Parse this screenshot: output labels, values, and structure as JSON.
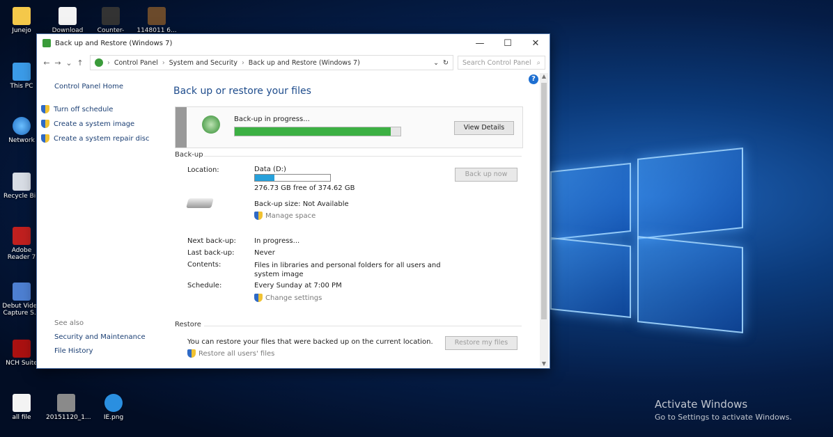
{
  "desktop": {
    "icons": [
      {
        "label": "Junejo",
        "icon": "folder-icon"
      },
      {
        "label": "Download",
        "icon": "document-icon"
      },
      {
        "label": "Counter-Str...",
        "icon": "app-icon"
      },
      {
        "label": "1148011 6...",
        "icon": "image-icon"
      },
      {
        "label": "This PC",
        "icon": "computer-icon"
      },
      {
        "label": "Network",
        "icon": "network-icon"
      },
      {
        "label": "Recycle Bin",
        "icon": "recycle-bin-icon"
      },
      {
        "label": "Adobe Reader 7",
        "icon": "pdf-icon"
      },
      {
        "label": "Debut Video Capture S...",
        "icon": "video-capture-icon"
      },
      {
        "label": "NCH Suite",
        "icon": "nch-icon"
      },
      {
        "label": "all file",
        "icon": "file-icon"
      },
      {
        "label": "20151120_1...",
        "icon": "archive-icon"
      },
      {
        "label": "IE.png",
        "icon": "ie-icon"
      }
    ],
    "activate": {
      "title": "Activate Windows",
      "subtitle": "Go to Settings to activate Windows."
    }
  },
  "window": {
    "title": "Back up and Restore (Windows 7)",
    "controls": {
      "minimize": "—",
      "maximize": "☐",
      "close": "✕"
    },
    "address": {
      "crumbs": [
        "Control Panel",
        "System and Security",
        "Back up and Restore (Windows 7)"
      ],
      "search_placeholder": "Search Control Panel"
    },
    "leftnav": {
      "home": "Control Panel Home",
      "items": [
        "Turn off schedule",
        "Create a system image",
        "Create a system repair disc"
      ],
      "see_also": "See also",
      "links": [
        "Security and Maintenance",
        "File History"
      ]
    },
    "main": {
      "heading": "Back up or restore your files",
      "progress": {
        "text": "Back-up in progress...",
        "fraction": 0.94,
        "button": "View Details"
      },
      "backup": {
        "section": "Back-up",
        "location_label": "Location:",
        "location_value": "Data (D:)",
        "drive_used_fraction": 0.26,
        "free_space": "276.73 GB free of 374.62 GB",
        "size": "Back-up size: Not Available",
        "manage_space": "Manage space",
        "backup_now": "Back up now",
        "next_label": "Next back-up:",
        "next_value": "In progress...",
        "last_label": "Last back-up:",
        "last_value": "Never",
        "contents_label": "Contents:",
        "contents_value": "Files in libraries and personal folders for all users and system image",
        "schedule_label": "Schedule:",
        "schedule_value": "Every Sunday at 7:00 PM",
        "change_settings": "Change settings"
      },
      "restore": {
        "section": "Restore",
        "text": "You can restore your files that were backed up on the current location.",
        "button": "Restore my files",
        "restore_all": "Restore all users' files"
      }
    }
  }
}
